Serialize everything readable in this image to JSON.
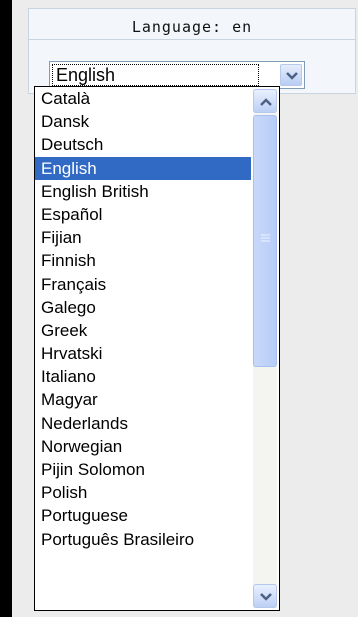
{
  "header": {
    "title": "Language: en"
  },
  "select": {
    "value": "English"
  },
  "dropdown": {
    "items": [
      "Català",
      "Dansk",
      "Deutsch",
      "English",
      "English British",
      "Español",
      "Fijian",
      "Finnish",
      "Français",
      "Galego",
      "Greek",
      "Hrvatski",
      "Italiano",
      "Magyar",
      "Nederlands",
      "Norwegian",
      "Pijin Solomon",
      "Polish",
      "Portuguese",
      "Português Brasileiro"
    ],
    "selected_index": 3,
    "scroll_fraction": 0.45
  },
  "colors": {
    "selection": "#316ac5",
    "panel": "#ececec"
  },
  "icons": {
    "scroll_up": "chevron-up-icon",
    "scroll_down": "chevron-down-icon",
    "select_arrow": "chevron-down-icon"
  }
}
